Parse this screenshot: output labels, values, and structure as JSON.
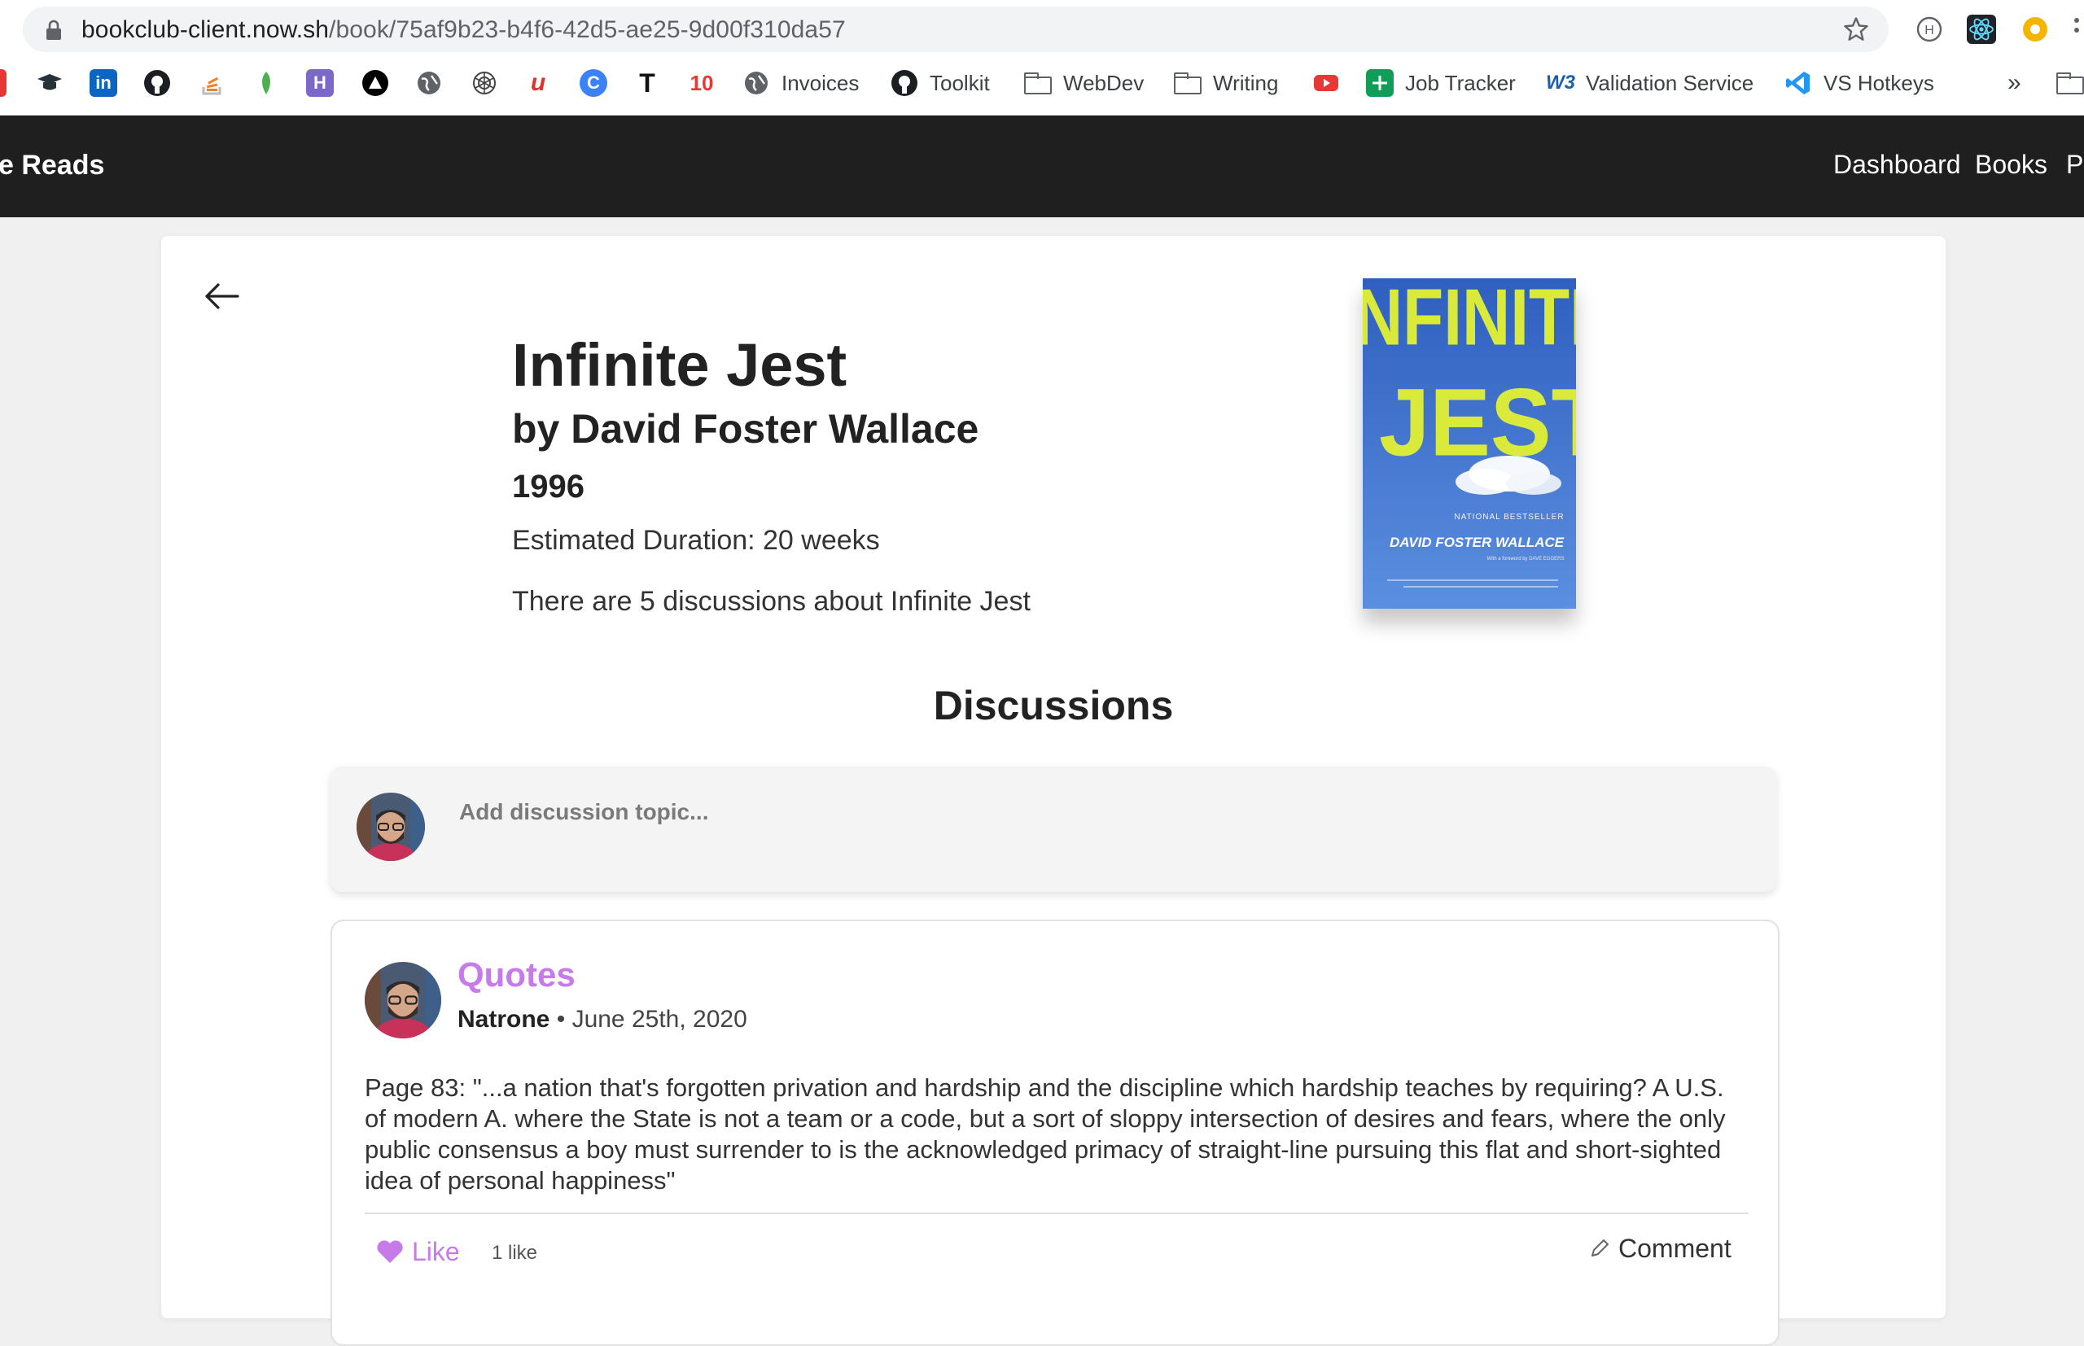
{
  "browser": {
    "url_host": "bookclub-client.now.sh",
    "url_path": "/book/75af9b23-b4f6-42d5-ae25-9d00f310da57",
    "bookmarks": [
      {
        "label": "Invoices",
        "icon": "globe-icon"
      },
      {
        "label": "Toolkit",
        "icon": "github-icon"
      },
      {
        "label": "WebDev",
        "icon": "folder-icon"
      },
      {
        "label": "Writing",
        "icon": "folder-icon"
      },
      {
        "label": "Job Tracker",
        "icon": "sheets-icon"
      },
      {
        "label": "Validation Service",
        "icon": "w3c-icon"
      },
      {
        "label": "VS Hotkeys",
        "icon": "vscode-icon"
      }
    ],
    "overflow_label": "»",
    "unlabeled_bookmark_icon_letters": {
      "linkedin": "in",
      "heroku": "H",
      "codepen_c": "C",
      "t": "T",
      "ten": "10",
      "u": "u"
    }
  },
  "nav": {
    "brand": "e Reads",
    "links": [
      "Dashboard",
      "Books",
      "P"
    ]
  },
  "book": {
    "title": "Infinite Jest",
    "author_line": "by David Foster Wallace",
    "year": "1996",
    "duration": "Estimated Duration: 20 weeks",
    "discussion_count_text": "There are 5 discussions about Infinite Jest",
    "cover": {
      "title_line1": "INFINITE",
      "title_line2": "JEST",
      "badge": "NATIONAL BESTSELLER",
      "author": "DAVID FOSTER WALLACE",
      "foreword": "With a foreword by DAVE EGGERS",
      "bg_color": "#3e6fc8",
      "title_color": "#d9ea3a"
    }
  },
  "discussions": {
    "heading": "Discussions",
    "add_placeholder": "Add discussion topic...",
    "posts": [
      {
        "title": "Quotes",
        "user": "Natrone",
        "separator": "•",
        "date": "June 25th, 2020",
        "body": "Page 83: \"...a nation that's forgotten privation and hardship and the discipline which hardship teaches by requiring? A U.S. of modern A. where the State is not a team or a code, but a sort of sloppy intersection of desires and fears, where the only public consensus a boy must surrender to is the acknowledged primacy of straight-line pursuing this flat and short-sighted idea of personal happiness\"",
        "like_label": "Like",
        "like_count": "1 like",
        "comment_label": "Comment"
      }
    ]
  },
  "colors": {
    "accent": "#c77be8",
    "nav_bg": "#1f1f1f",
    "page_bg": "#f0f0f0"
  }
}
